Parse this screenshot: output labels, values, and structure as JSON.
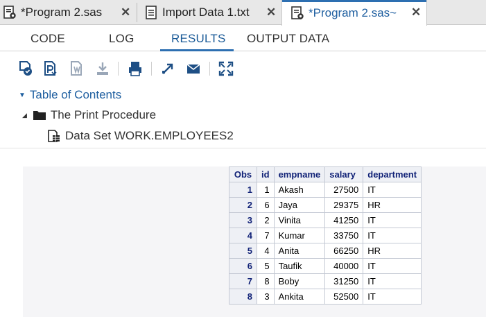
{
  "file_tabs": [
    {
      "label": "*Program 2.sas",
      "icon": "sas-program-icon",
      "active": false
    },
    {
      "label": "Import Data 1.txt",
      "icon": "document-icon",
      "active": false
    },
    {
      "label": "*Program 2.sas~",
      "icon": "sas-program-icon",
      "active": true
    }
  ],
  "close_glyph": "✕",
  "sub_tabs": [
    {
      "label": "CODE"
    },
    {
      "label": "LOG"
    },
    {
      "label": "RESULTS",
      "active": true
    },
    {
      "label": "OUTPUT DATA"
    }
  ],
  "toolbar": {
    "icons": [
      "download-html-icon",
      "download-pdf-icon",
      "download-rtf-icon",
      "download-icon",
      "print-icon",
      "open-new-window-icon",
      "email-icon",
      "maximize-icon"
    ]
  },
  "toc": {
    "title": "Table of Contents",
    "procedure": "The Print Procedure",
    "dataset": "Data Set WORK.EMPLOYEES2"
  },
  "table": {
    "headers": [
      "Obs",
      "id",
      "empname",
      "salary",
      "department"
    ],
    "rows": [
      [
        "1",
        "1",
        "Akash",
        "27500",
        "IT"
      ],
      [
        "2",
        "6",
        "Jaya",
        "29375",
        "HR"
      ],
      [
        "3",
        "2",
        "Vinita",
        "41250",
        "IT"
      ],
      [
        "4",
        "7",
        "Kumar",
        "33750",
        "IT"
      ],
      [
        "5",
        "4",
        "Anita",
        "66250",
        "HR"
      ],
      [
        "6",
        "5",
        "Taufik",
        "40000",
        "IT"
      ],
      [
        "7",
        "8",
        "Boby",
        "31250",
        "IT"
      ],
      [
        "8",
        "3",
        "Ankita",
        "52500",
        "IT"
      ]
    ]
  },
  "colors": {
    "accent": "#2d6fb1",
    "active_text": "#1f5fa0",
    "table_header_text": "#112277"
  }
}
